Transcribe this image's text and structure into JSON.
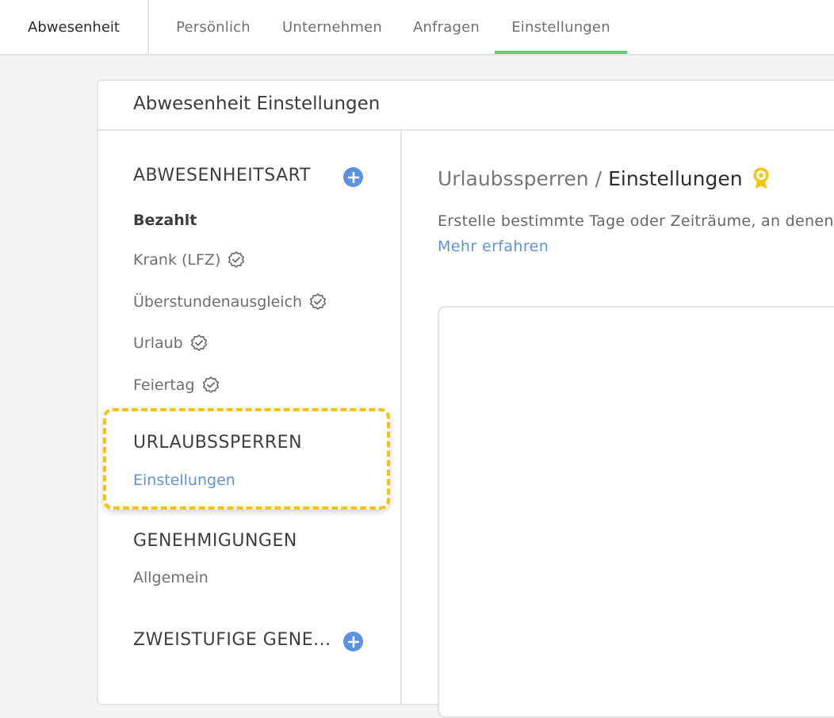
{
  "topnav": {
    "module": "Abwesenheit",
    "tabs": [
      {
        "label": "Persönlich"
      },
      {
        "label": "Unternehmen"
      },
      {
        "label": "Anfragen"
      },
      {
        "label": "Einstellungen"
      }
    ],
    "active_tab": "Einstellungen",
    "active_color": "#5cd47c"
  },
  "panel": {
    "title": "Abwesenheit Einstellungen"
  },
  "sidebar": {
    "absence_type": {
      "heading": "ABWESENHEITSART",
      "add_icon": "plus-circle-icon",
      "items": [
        {
          "label": "Bezahlt"
        },
        {
          "label": "Krank (LFZ)",
          "icon": "verified-badge-icon"
        },
        {
          "label": "Überstundenausgleich",
          "icon": "verified-badge-icon"
        },
        {
          "label": "Urlaub",
          "icon": "verified-badge-icon"
        },
        {
          "label": "Feiertag",
          "icon": "verified-badge-icon"
        }
      ]
    },
    "blackout": {
      "heading": "URLAUBSSPERREN",
      "items": [
        {
          "label": "Einstellungen"
        }
      ]
    },
    "approvals": {
      "heading": "GENEHMIGUNGEN",
      "items": [
        {
          "label": "Allgemein"
        }
      ]
    },
    "two_step": {
      "heading": "ZWEISTUFIGE GENE...",
      "add_icon": "plus-circle-icon"
    },
    "highlight_color": "#f7c30e",
    "link_color": "#5e93d7",
    "plus_color": "#5b93e0"
  },
  "content": {
    "breadcrumb_parent": "Urlaubssperren",
    "breadcrumb_separator": "/",
    "breadcrumb_current": "Einstellungen",
    "premium_icon": "award-badge-icon",
    "description": "Erstelle bestimmte Tage oder Zeiträume, an denen",
    "more_link": "Mehr erfahren"
  }
}
